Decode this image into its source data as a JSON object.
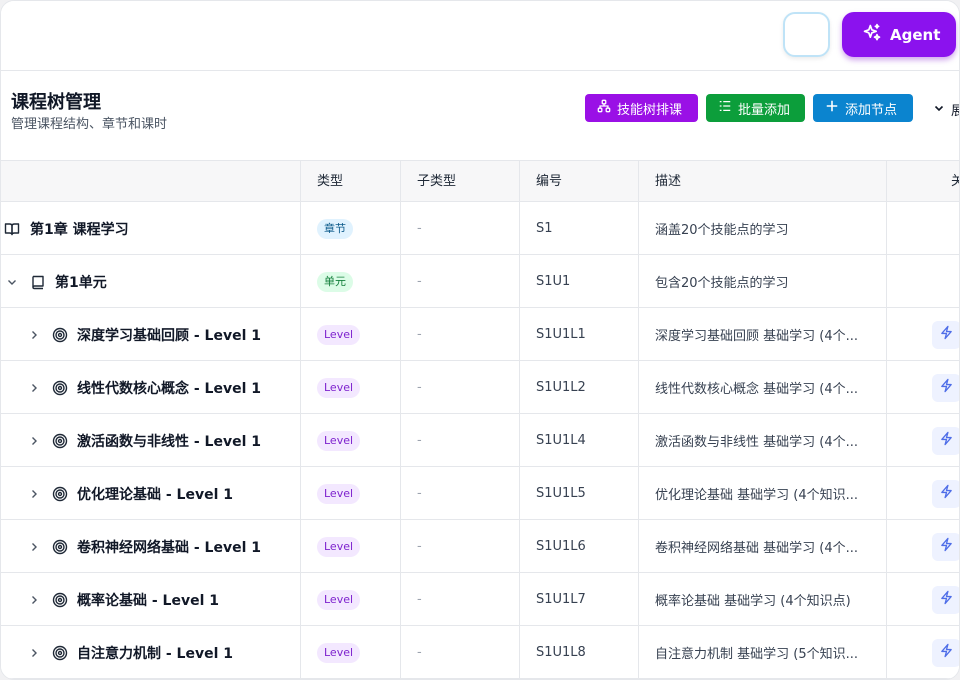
{
  "topbar": {
    "agent_label": "Agent"
  },
  "header": {
    "title": "课程树管理",
    "subtitle": "管理课程结构、章节和课时",
    "btn_skill": "技能树排课",
    "btn_batch": "批量添加",
    "btn_add": "添加节点",
    "expand_label": "展"
  },
  "columns": {
    "name": "",
    "type": "类型",
    "subtype": "子类型",
    "code": "编号",
    "desc": "描述",
    "action": "关"
  },
  "rows": [
    {
      "name": "第1章 课程学习",
      "type": "章节",
      "subtype": "-",
      "code": "S1",
      "desc": "涵盖20个技能点的学习"
    },
    {
      "name": "第1单元",
      "type": "单元",
      "subtype": "-",
      "code": "S1U1",
      "desc": "包含20个技能点的学习"
    },
    {
      "name": "深度学习基础回顾 - Level 1",
      "type": "Level",
      "subtype": "-",
      "code": "S1U1L1",
      "desc": "深度学习基础回顾 基础学习 (4个..."
    },
    {
      "name": "线性代数核心概念 - Level 1",
      "type": "Level",
      "subtype": "-",
      "code": "S1U1L2",
      "desc": "线性代数核心概念 基础学习 (4个..."
    },
    {
      "name": "激活函数与非线性 - Level 1",
      "type": "Level",
      "subtype": "-",
      "code": "S1U1L4",
      "desc": "激活函数与非线性 基础学习 (4个..."
    },
    {
      "name": "优化理论基础 - Level 1",
      "type": "Level",
      "subtype": "-",
      "code": "S1U1L5",
      "desc": "优化理论基础 基础学习 (4个知识..."
    },
    {
      "name": "卷积神经网络基础 - Level 1",
      "type": "Level",
      "subtype": "-",
      "code": "S1U1L6",
      "desc": "卷积神经网络基础 基础学习 (4个..."
    },
    {
      "name": "概率论基础 - Level 1",
      "type": "Level",
      "subtype": "-",
      "code": "S1U1L7",
      "desc": "概率论基础 基础学习 (4个知识点)"
    },
    {
      "name": "自注意力机制 - Level 1",
      "type": "Level",
      "subtype": "-",
      "code": "S1U1L8",
      "desc": "自注意力机制 基础学习 (5个知识..."
    }
  ],
  "colors": {
    "agent": "#8b12ee",
    "skill_button": "#9a10e6",
    "batch_button": "#0c9e3b",
    "add_button": "#0b84cf",
    "chapter_badge": "#e0f2fe",
    "unit_badge": "#dcfce7",
    "level_badge": "#f3e8ff"
  }
}
